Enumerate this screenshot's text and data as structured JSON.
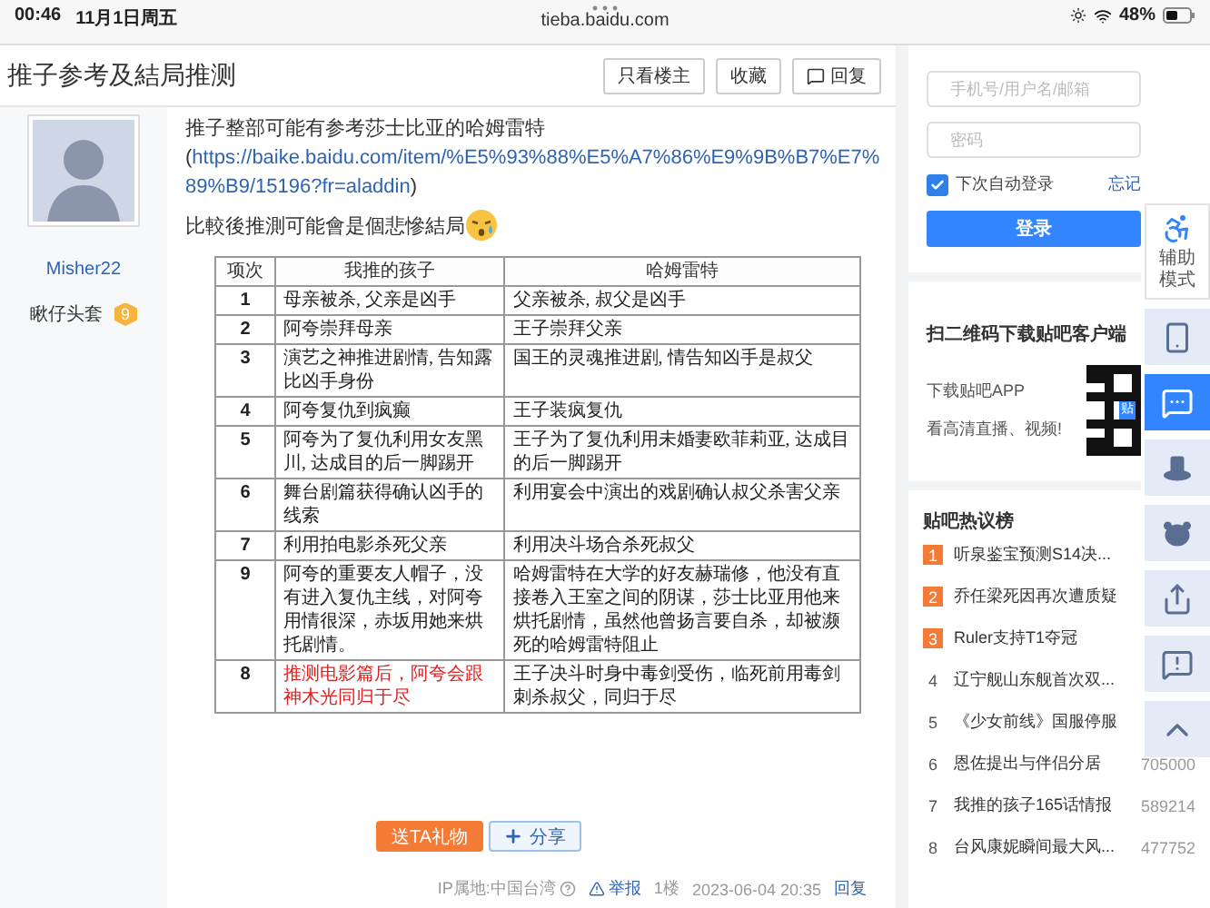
{
  "status_bar": {
    "time": "00:46",
    "date": "11月1日周五",
    "url": "tieba.baidu.com",
    "battery": "48%"
  },
  "thread": {
    "title": "推子参考及結局推测",
    "buttons": [
      {
        "label": "只看楼主",
        "kind": "plain"
      },
      {
        "label": "收藏",
        "kind": "plain"
      },
      {
        "label": "回复",
        "kind": "reply"
      }
    ]
  },
  "post": {
    "author": {
      "name": "Misher22",
      "title": "瞅仔头套",
      "level": "9"
    },
    "intro": "推子整部可能有参考莎士比亚的哈姆雷特",
    "link": {
      "prefix": "(",
      "url": "https://baike.baidu.com/item/%E5%93%88%E5%A7%86%E9%9B%B7%E7%89%B9/15196?fr=aladdin",
      "suffix": ")"
    },
    "ending": "比較後推測可能會是個悲慘結局",
    "table": {
      "columns": [
        "项次",
        "我推的孩子",
        "哈姆雷特"
      ],
      "rows": [
        {
          "cells": [
            "1",
            "母亲被杀, 父亲是凶手",
            "父亲被杀, 叔父是凶手"
          ],
          "highlighted": false
        },
        {
          "cells": [
            "2",
            "阿夸崇拜母亲",
            "王子崇拜父亲"
          ],
          "highlighted": false
        },
        {
          "cells": [
            "3",
            "演艺之神推进剧情, 告知露比凶手身份",
            "国王的灵魂推进剧, 情告知凶手是叔父"
          ],
          "highlighted": false
        },
        {
          "cells": [
            "4",
            "阿夸复仇到疯癫",
            "王子装疯复仇"
          ],
          "highlighted": false
        },
        {
          "cells": [
            "5",
            "阿夸为了复仇利用女友黑川, 达成目的后一脚踢开",
            "王子为了复仇利用未婚妻欧菲莉亚, 达成目的后一脚踢开"
          ],
          "highlighted": false
        },
        {
          "cells": [
            "6",
            "舞台剧篇获得确认凶手的线索",
            "利用宴会中演出的戏剧确认叔父杀害父亲"
          ],
          "highlighted": false
        },
        {
          "cells": [
            "7",
            "利用拍电影杀死父亲",
            "利用决斗场合杀死叔父"
          ],
          "highlighted": false
        },
        {
          "cells": [
            "9",
            "阿夸的重要友人帽子，没有进入复仇主线，对阿夸用情很深，赤坂用她来烘托剧情。",
            "哈姆雷特在大学的好友赫瑞修，他没有直接卷入王室之间的阴谋，莎士比亚用他来烘托剧情，虽然他曾扬言要自杀，却被濒死的哈姆雷特阻止"
          ],
          "highlighted": false
        },
        {
          "cells": [
            "8",
            "推测电影篇后，阿夸会跟神木光同归于尽",
            "王子决斗时身中毒剑受伤，临死前用毒剑刺杀叔父，同归于尽"
          ],
          "highlighted": true
        }
      ]
    },
    "actions": [
      {
        "label": "送TA礼物",
        "kind": "gift"
      },
      {
        "label": "分享",
        "kind": "share"
      }
    ],
    "footer": {
      "ip": "IP属地:中国台湾",
      "report": "举报",
      "floor": "1楼",
      "time": "2023-06-04 20:35",
      "reply": "回复"
    }
  },
  "sidebar": {
    "login": {
      "username_placeholder": "手机号/用户名/邮箱",
      "password_placeholder": "密码",
      "remember": {
        "label": "下次自动登录",
        "checked": true
      },
      "forgot": "忘记",
      "button": "登录"
    },
    "app": {
      "title": "扫二维码下载贴吧客户端",
      "lines": [
        "下载贴吧APP",
        "看高清直播、视频!"
      ],
      "qr_badge": "贴"
    },
    "hot": {
      "title": "贴吧热议榜",
      "items": [
        {
          "rank": "1",
          "title": "听泉鉴宝预测S14决...",
          "top": true
        },
        {
          "rank": "2",
          "title": "乔任梁死因再次遭质疑",
          "top": true
        },
        {
          "rank": "3",
          "title": "Ruler支持T1夺冠",
          "top": true
        },
        {
          "rank": "4",
          "title": "辽宁舰山东舰首次双...",
          "top": false
        },
        {
          "rank": "5",
          "title": "《少女前线》国服停服",
          "top": false
        },
        {
          "rank": "6",
          "title": "恩佐提出与伴侣分居",
          "count": "705000",
          "top": false
        },
        {
          "rank": "7",
          "title": "我推的孩子165话情报",
          "count": "589214",
          "top": false
        },
        {
          "rank": "8",
          "title": "台风康妮瞬间最大风...",
          "count": "477752",
          "top": false
        }
      ]
    }
  },
  "floating_toolbar": [
    {
      "kind": "accessibility",
      "label": "辅助模式",
      "selected": false
    },
    {
      "kind": "download",
      "selected": false
    },
    {
      "kind": "chat",
      "selected": true
    },
    {
      "kind": "hat",
      "selected": false
    },
    {
      "kind": "bear",
      "selected": false
    },
    {
      "kind": "share",
      "selected": false
    },
    {
      "kind": "report",
      "selected": false
    },
    {
      "kind": "top",
      "selected": false
    }
  ]
}
